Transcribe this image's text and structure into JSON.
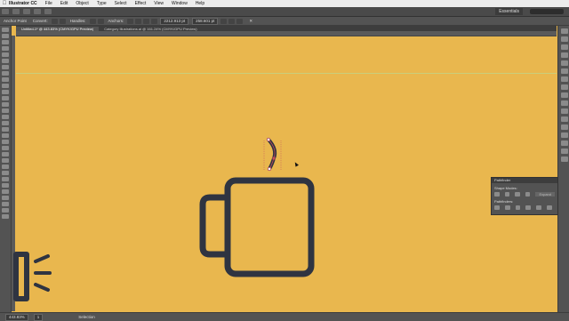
{
  "menubar": {
    "app": "Illustrator CC",
    "items": [
      "File",
      "Edit",
      "Object",
      "Type",
      "Select",
      "Effect",
      "View",
      "Window",
      "Help"
    ]
  },
  "appbar": {
    "workspace": "Essentials"
  },
  "control": {
    "anchor_label": "Anchor Point",
    "convert_label": "Convert:",
    "handles_label": "Handles:",
    "anchors_label": "Anchors:",
    "x_value": "2212.913 pt",
    "y_value": "258.601 pt"
  },
  "tabs": [
    "Untitled-1* @ 443.83% (CMYK/GPU Preview)",
    "Category Illustrations.ai @ 161.24% (CMYK/GPU Preview)"
  ],
  "status": {
    "zoom": "443.83%",
    "artboard": "1",
    "tool": "Selection"
  },
  "pathfinder": {
    "title": "Pathfinder",
    "shape_modes": "Shape Modes:",
    "pathfinders": "Pathfinders:",
    "expand": "Expand"
  },
  "colors": {
    "canvas": "#E9B74E",
    "stroke": "#2F3441",
    "guide": "#C9CF7C"
  }
}
